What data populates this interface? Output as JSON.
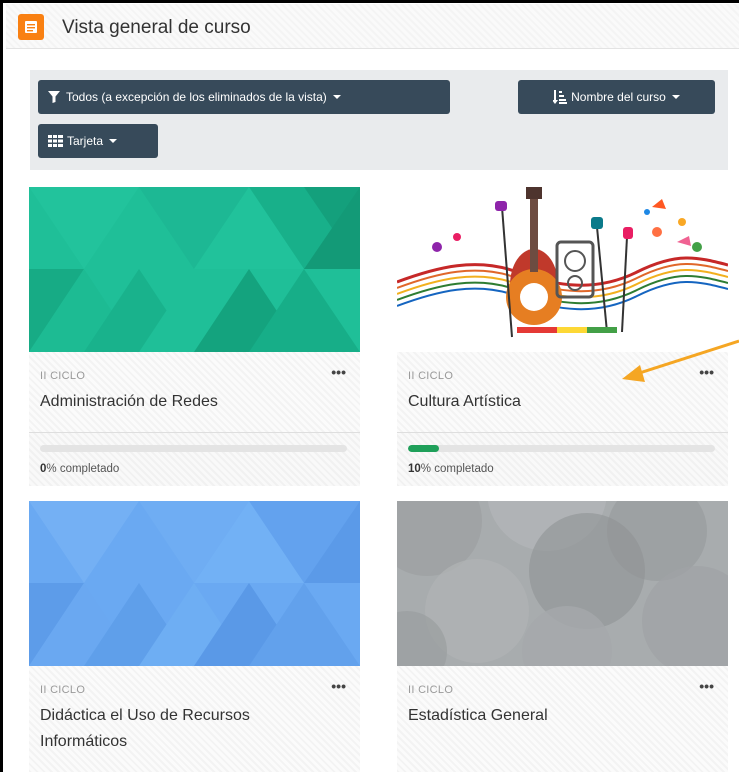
{
  "block": {
    "title": "Vista general de curso",
    "icon": "book-icon",
    "icon_color": "#f98012"
  },
  "filters": {
    "grouping_label": "Todos (a excepción de los eliminados de la vista)",
    "sort_label": "Nombre del curso",
    "view_label": "Tarjeta",
    "button_color": "#374a5a"
  },
  "courses": [
    {
      "category": "II CICLO",
      "name": "Administración de Redes",
      "progress_value": "0",
      "progress_suffix": "% completado",
      "progress_fraction": 0.0,
      "image": "teal-triangle-pattern"
    },
    {
      "category": "II CICLO",
      "name": "Cultura Artística",
      "progress_value": "10",
      "progress_suffix": "% completado",
      "progress_fraction": 0.1,
      "image": "music-instruments-illustration"
    },
    {
      "category": "II CICLO",
      "name": "Didáctica el Uso de Recursos Informáticos",
      "image": "blue-triangle-pattern"
    },
    {
      "category": "II CICLO",
      "name": "Estadística General",
      "image": "grey-circle-pattern"
    }
  ],
  "menu_glyph": "•••",
  "colors": {
    "progress": "#1fa05a",
    "arrow": "#f5a623"
  }
}
